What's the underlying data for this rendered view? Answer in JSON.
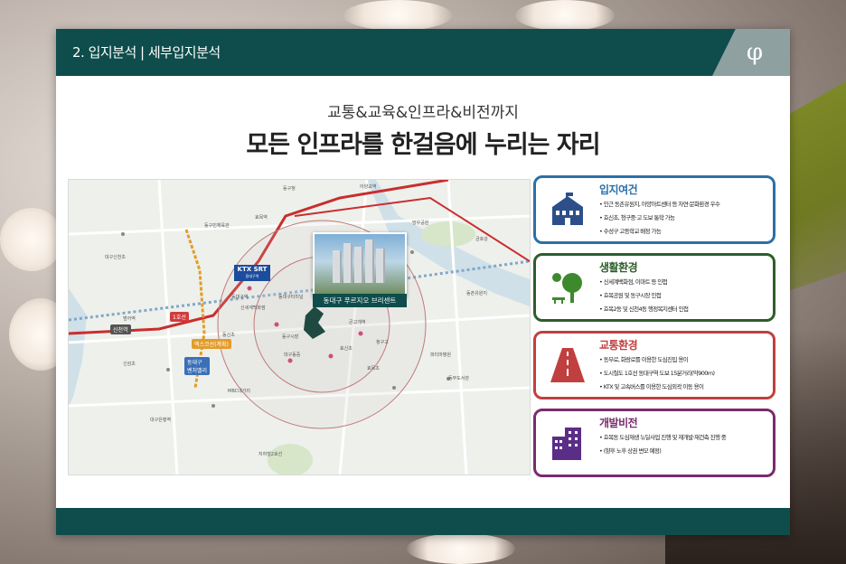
{
  "header": {
    "section": "2. 입지분석 | 세부입지분석",
    "logo_icon": "phi-logo-icon"
  },
  "headline": {
    "subtitle": "교통&교육&인프라&비전까지",
    "title": "모든 인프라를 한걸음에 누리는 자리"
  },
  "map": {
    "project_label": "동대구 푸르지오 브리센트",
    "ktx_label": "KTX SRT",
    "ktx_sub": "동대구역",
    "badges": [
      {
        "text": "엑스코선(계획)",
        "color": "#e39c2b"
      },
      {
        "text": "동대구\n벤처밸리",
        "color": "#3b6fb8"
      },
      {
        "text": "신천역",
        "color": "#555555"
      },
      {
        "text": "1호선",
        "color": "#d23b3b"
      }
    ],
    "labels": [
      "동구청",
      "아양교역",
      "효목역",
      "동구민체육관",
      "대구신천초",
      "동대구역",
      "신세계백화점",
      "동대구터미널",
      "동신초",
      "효신초",
      "대구동중",
      "효목초",
      "동부도서관",
      "큰고개역",
      "MBC네거리",
      "동촌유원지",
      "금호강",
      "망우공원",
      "동구시장",
      "청구고",
      "신암초",
      "대구은행역",
      "지하철2호선",
      "범어역",
      "파티마병원"
    ]
  },
  "cards": [
    {
      "title": "입지여건",
      "color": "#2c6fa8",
      "icon": "school-building-icon",
      "items": [
        "인근 동촌유원지, 아양아트센터 등 자연·문화환경 우수",
        "효신초, 청구중·고 도보 통학 가능",
        "수성구 고등학교 배정 가능"
      ]
    },
    {
      "title": "생활환경",
      "color": "#2e5d2a",
      "icon": "park-tree-icon",
      "items": [
        "신세계백화점, 이마트 등 인접",
        "효목공원 및 동구시장 인접",
        "효목2동 및 신천4동 행정복지센터 인접"
      ]
    },
    {
      "title": "교통환경",
      "color": "#c0403f",
      "icon": "road-icon",
      "items": [
        "동부로, 화랑로를 이용한 도심진입 용이",
        "도시철도 1호선 동대구역 도보 15분거리(약900m)",
        "KTX 및 고속버스를 이용한 도심외곽 이동 용이"
      ]
    },
    {
      "title": "개발비전",
      "color": "#7a2b6e",
      "icon": "city-building-icon",
      "items": [
        "효목동 도심재생 뉴딜사업 진행 및 재개발·재건축 진행 중",
        "(향후 노후 상권 변모 예정)"
      ]
    }
  ]
}
